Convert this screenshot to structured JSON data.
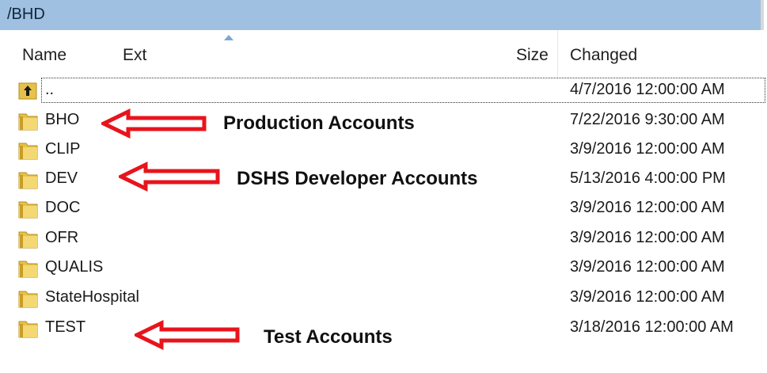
{
  "path": "/BHD",
  "columns": {
    "name": "Name",
    "ext": "Ext",
    "size": "Size",
    "changed": "Changed"
  },
  "rows": [
    {
      "name": "..",
      "changed": "4/7/2016 12:00:00 AM",
      "icon": "parent-folder-icon"
    },
    {
      "name": "BHO",
      "changed": "7/22/2016 9:30:00 AM",
      "icon": "folder-icon"
    },
    {
      "name": "CLIP",
      "changed": "3/9/2016 12:00:00 AM",
      "icon": "folder-icon"
    },
    {
      "name": "DEV",
      "changed": "5/13/2016 4:00:00 PM",
      "icon": "folder-icon"
    },
    {
      "name": "DOC",
      "changed": "3/9/2016 12:00:00 AM",
      "icon": "folder-icon"
    },
    {
      "name": "OFR",
      "changed": "3/9/2016 12:00:00 AM",
      "icon": "folder-icon"
    },
    {
      "name": "QUALIS",
      "changed": "3/9/2016 12:00:00 AM",
      "icon": "folder-icon"
    },
    {
      "name": "StateHospital",
      "changed": "3/9/2016 12:00:00 AM",
      "icon": "folder-icon"
    },
    {
      "name": "TEST",
      "changed": "3/18/2016 12:00:00 AM",
      "icon": "folder-icon"
    }
  ],
  "annotations": {
    "production": "Production Accounts",
    "developer": "DSHS Developer Accounts",
    "test": "Test Accounts"
  },
  "colors": {
    "pathbar": "#9fc0e0",
    "arrow": "#e8141c",
    "folder": "#e6c24a"
  }
}
